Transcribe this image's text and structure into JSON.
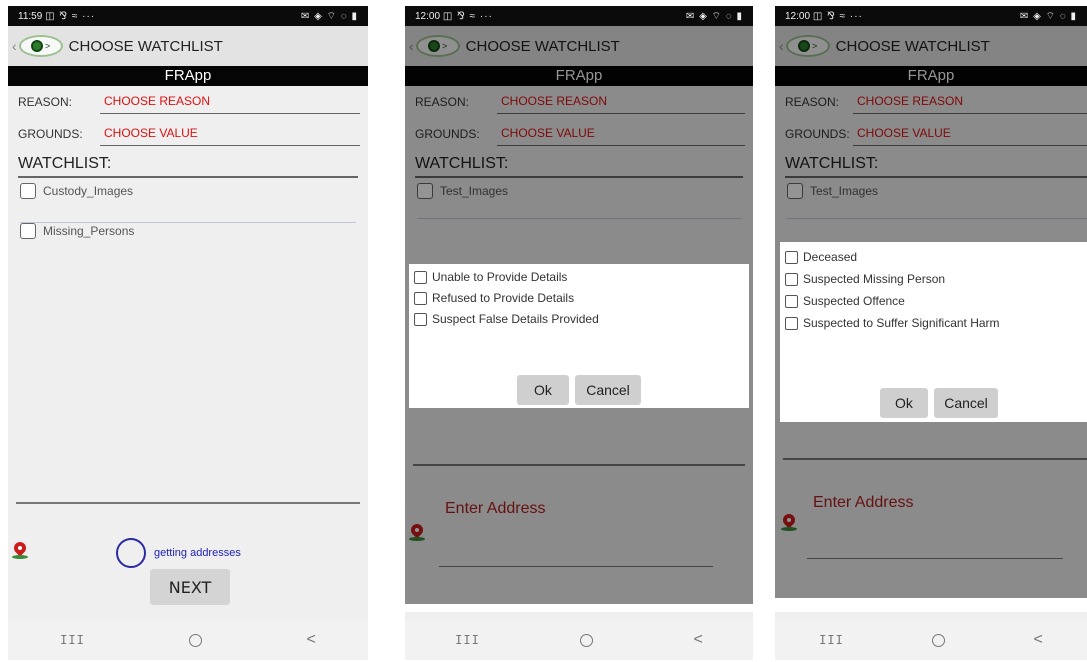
{
  "screens": [
    {
      "status": {
        "time": "11:59",
        "left_icons": "◫ ⅋ ≈ ···",
        "right_icons": "✉ ◈ ⌔ ◌ ▮"
      },
      "title": "CHOOSE WATCHLIST",
      "app_name": "FRApp",
      "reason_label": "REASON:",
      "reason_value": "CHOOSE REASON",
      "grounds_label": "GROUNDS:",
      "grounds_value": "CHOOSE VALUE",
      "watchlist_label": "WATCHLIST:",
      "watchlists": [
        "Custody_Images",
        "Missing_Persons"
      ],
      "address_status": "getting addresses",
      "next_label": "NEXT",
      "nav": {
        "recents": "III",
        "back": "<"
      }
    },
    {
      "status": {
        "time": "12:00",
        "left_icons": "◫ ⅋ ≈ ···",
        "right_icons": "✉ ◈ ⌔ ◌ ▮"
      },
      "title": "CHOOSE WATCHLIST",
      "app_name": "FRApp",
      "reason_label": "REASON:",
      "reason_value": "CHOOSE REASON",
      "grounds_label": "GROUNDS:",
      "grounds_value": "CHOOSE VALUE",
      "watchlist_label": "WATCHLIST:",
      "watchlists": [
        "Test_Images"
      ],
      "dialog_options": [
        "Unable to Provide Details",
        "Refused to Provide Details",
        "Suspect False Details Provided"
      ],
      "ok_label": "Ok",
      "cancel_label": "Cancel",
      "address_placeholder": "Enter Address",
      "nav": {
        "recents": "III",
        "back": "<"
      }
    },
    {
      "status": {
        "time": "12:00",
        "left_icons": "◫ ⅋ ≈ ···",
        "right_icons": "✉ ◈ ⌔ ◌ ▮"
      },
      "title": "CHOOSE WATCHLIST",
      "app_name": "FRApp",
      "reason_label": "REASON:",
      "reason_value": "CHOOSE REASON",
      "grounds_label": "GROUNDS:",
      "grounds_value": "CHOOSE VALUE",
      "watchlist_label": "WATCHLIST:",
      "watchlists": [
        "Test_Images"
      ],
      "dialog_options": [
        "Deceased",
        "Suspected Missing Person",
        "Suspected Offence",
        "Suspected to Suffer Significant Harm"
      ],
      "ok_label": "Ok",
      "cancel_label": "Cancel",
      "address_placeholder": "Enter Address",
      "nav": {
        "recents": "III",
        "back": "<"
      }
    }
  ],
  "colors": {
    "value_red": "#dd1111",
    "status_blue": "#2121b8",
    "overlay": "#000000"
  }
}
